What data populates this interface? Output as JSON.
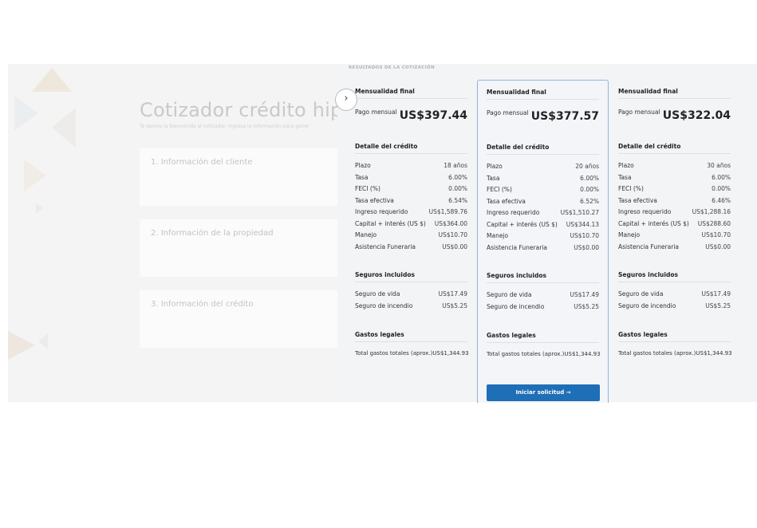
{
  "left": {
    "title": "Cotizador crédito hipot",
    "subtitle": "Te damos la bienvenida al cotizador. Ingresa la información para gener",
    "sections": [
      "1. Información del cliente",
      "2. Información de la propiedad",
      "3. Información del crédito"
    ]
  },
  "results": {
    "title": "RESULTADOS DE LA COTIZACIÓN",
    "toggle_icon": "›",
    "button_label": "Iniciar solicitud →",
    "columns": [
      {
        "mensualidad": "Mensualidad final",
        "pago_label": "Pago mensual",
        "pago_value": "US$397.44",
        "detalle": "Detalle del crédito",
        "rows": [
          {
            "label": "Plazo",
            "value": "18 años"
          },
          {
            "label": "Tasa",
            "value": "6.00%"
          },
          {
            "label": "FECI (%)",
            "value": "0.00%"
          },
          {
            "label": "Tasa efectiva",
            "value": "6.54%"
          },
          {
            "label": "Ingreso requerido",
            "value": "US$1,589.76"
          },
          {
            "label": "Capital + interés (US $)",
            "value": "US$364.00"
          },
          {
            "label": "Manejo",
            "value": "US$10.70"
          },
          {
            "label": "Asistencia Funeraria",
            "value": "US$0.00"
          }
        ],
        "seguros": "Seguros incluidos",
        "seguro_rows": [
          {
            "label": "Seguro de vida",
            "value": "US$17.49"
          },
          {
            "label": "Seguro de incendio",
            "value": "US$5.25"
          }
        ],
        "gastos": "Gastos legales",
        "total": "Total gastos totales (aprox.)US$1,344.93"
      },
      {
        "mensualidad": "Mensualidad final",
        "pago_label": "Pago mensual",
        "pago_value": "US$377.57",
        "detalle": "Detalle del crédito",
        "rows": [
          {
            "label": "Plazo",
            "value": "20 años"
          },
          {
            "label": "Tasa",
            "value": "6.00%"
          },
          {
            "label": "FECI (%)",
            "value": "0.00%"
          },
          {
            "label": "Tasa efectiva",
            "value": "6.52%"
          },
          {
            "label": "Ingreso requerido",
            "value": "US$1,510.27"
          },
          {
            "label": "Capital + interés (US $)",
            "value": "US$344.13"
          },
          {
            "label": "Manejo",
            "value": "US$10.70"
          },
          {
            "label": "Asistencia Funeraria",
            "value": "US$0.00"
          }
        ],
        "seguros": "Seguros incluidos",
        "seguro_rows": [
          {
            "label": "Seguro de vida",
            "value": "US$17.49"
          },
          {
            "label": "Seguro de incendio",
            "value": "US$5.25"
          }
        ],
        "gastos": "Gastos legales",
        "total": "Total gastos totales (aprox.)US$1,344.93"
      },
      {
        "mensualidad": "Mensualidad final",
        "pago_label": "Pago mensual",
        "pago_value": "US$322.04",
        "detalle": "Detalle del crédito",
        "rows": [
          {
            "label": "Plazo",
            "value": "30 años"
          },
          {
            "label": "Tasa",
            "value": "6.00%"
          },
          {
            "label": "FECI (%)",
            "value": "0.00%"
          },
          {
            "label": "Tasa efectiva",
            "value": "6.46%"
          },
          {
            "label": "Ingreso requerido",
            "value": "US$1,288.16"
          },
          {
            "label": "Capital + interés (US $)",
            "value": "US$288.60"
          },
          {
            "label": "Manejo",
            "value": "US$10.70"
          },
          {
            "label": "Asistencia Funeraria",
            "value": "US$0.00"
          }
        ],
        "seguros": "Seguros incluidos",
        "seguro_rows": [
          {
            "label": "Seguro de vida",
            "value": "US$17.49"
          },
          {
            "label": "Seguro de incendio",
            "value": "US$5.25"
          }
        ],
        "gastos": "Gastos legales",
        "total": "Total gastos totales (aprox.)US$1,344.93"
      }
    ]
  },
  "colors": {
    "accent": "#1f6fb7",
    "highlight_border": "#8fb6d8",
    "panel_bg": "#f2f4f6"
  }
}
